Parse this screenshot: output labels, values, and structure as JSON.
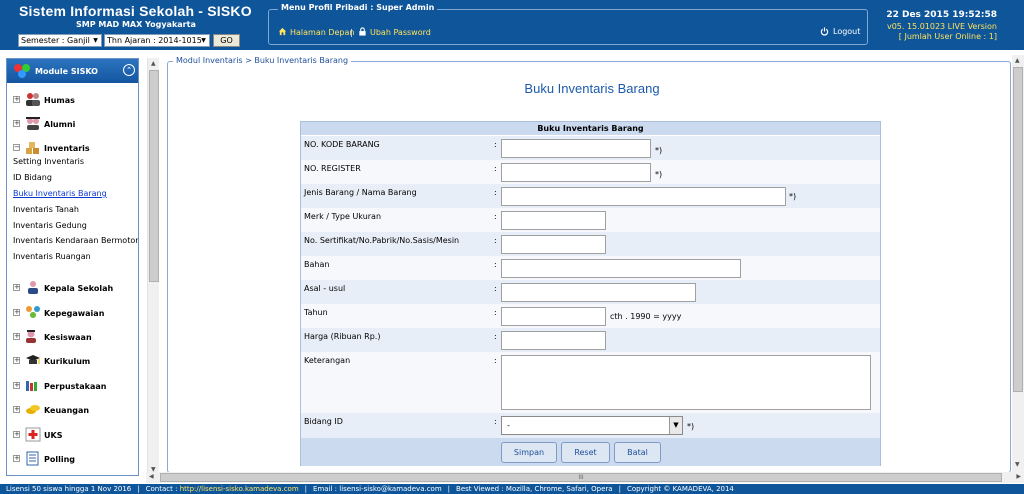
{
  "header": {
    "app_title": "Sistem Informasi Sekolah - SISKO",
    "school": "SMP MAD MAX Yogyakarta",
    "semester_select": "Semester : Ganjil",
    "tahun_ajaran_select": "Thn Ajaran : 2014-1015",
    "go_label": "GO",
    "menu_profil_title": "Menu Profil Pribadi : Super Admin",
    "halaman_depan": "Halaman Depan",
    "separator": "|",
    "ubah_password": "Ubah Password",
    "logout": "Logout",
    "datetime": "22 Des 2015 19:52:58",
    "version": "v05. 15.01023 LIVE Version",
    "online": "[ Jumlah User Online : 1]"
  },
  "sidebar": {
    "title": "Module SISKO",
    "groups": [
      {
        "label": "Humas",
        "icon": "people-icon",
        "toggle": "+"
      },
      {
        "label": "Alumni",
        "icon": "graduates-icon",
        "toggle": "+"
      },
      {
        "label": "Inventaris",
        "icon": "boxes-icon",
        "toggle": "−"
      },
      {
        "label": "Kepala Sekolah",
        "icon": "headmaster-icon",
        "toggle": "+"
      },
      {
        "label": "Kepegawaian",
        "icon": "staff-icon",
        "toggle": "+"
      },
      {
        "label": "Kesiswaan",
        "icon": "students-icon",
        "toggle": "+"
      },
      {
        "label": "Kurikulum",
        "icon": "mortarboard-icon",
        "toggle": "+"
      },
      {
        "label": "Perpustakaan",
        "icon": "books-icon",
        "toggle": "+"
      },
      {
        "label": "Keuangan",
        "icon": "money-icon",
        "toggle": "+"
      },
      {
        "label": "UKS",
        "icon": "medical-cross-icon",
        "toggle": "+"
      },
      {
        "label": "Polling",
        "icon": "document-icon",
        "toggle": "+"
      }
    ],
    "inventaris_items": [
      "Setting Inventaris",
      "ID Bidang",
      "Buku Inventaris Barang",
      "Inventaris Tanah",
      "Inventaris Gedung",
      "Inventaris Kendaraan Bermotor",
      "Inventaris Ruangan"
    ]
  },
  "main": {
    "breadcrumb": "Modul Inventaris > Buku Inventaris Barang",
    "page_title": "Buku Inventaris Barang",
    "form_heading": "Buku Inventaris Barang",
    "colon": ":",
    "required_mark": "*)",
    "fields": {
      "kode_barang": {
        "label": "NO. KODE BARANG",
        "value": ""
      },
      "register": {
        "label": "NO. REGISTER",
        "value": ""
      },
      "jenis_barang": {
        "label": "Jenis Barang / Nama Barang",
        "value": ""
      },
      "merk": {
        "label": "Merk / Type Ukuran",
        "value": ""
      },
      "sertifikat": {
        "label": "No. Sertifikat/No.Pabrik/No.Sasis/Mesin",
        "value": ""
      },
      "bahan": {
        "label": "Bahan",
        "value": ""
      },
      "asal_usul": {
        "label": "Asal - usul",
        "value": ""
      },
      "tahun": {
        "label": "Tahun",
        "value": "",
        "hint": "cth . 1990 = yyyy"
      },
      "harga": {
        "label": "Harga (Ribuan Rp.)",
        "value": ""
      },
      "keterangan": {
        "label": "Keterangan",
        "value": ""
      },
      "bidang_id": {
        "label": "Bidang ID",
        "value": "-"
      }
    },
    "buttons": {
      "simpan": "Simpan",
      "reset": "Reset",
      "batal": "Batal"
    }
  },
  "scrollbar": {
    "h_thumb_grip": "III"
  },
  "footer": {
    "lisensi": "Lisensi 50 siswa hingga 1 Nov 2016",
    "contact_label": "Contact :",
    "contact_link": "http://lisensi-sisko.kamadeva.com",
    "email": "Email : lisensi-sisko@kamadeva.com",
    "best_viewed": "Best Viewed : Mozilla, Chrome, Safari, Opera",
    "copyright": "Copyright © KAMADEVA, 2014",
    "separator": "|"
  },
  "colors": {
    "header_bg": "#0f5599",
    "accent_link": "#ffe45c",
    "title_blue": "#1b5aaa",
    "row_odd": "#e8eef8",
    "form_head": "#ccdaf0"
  }
}
